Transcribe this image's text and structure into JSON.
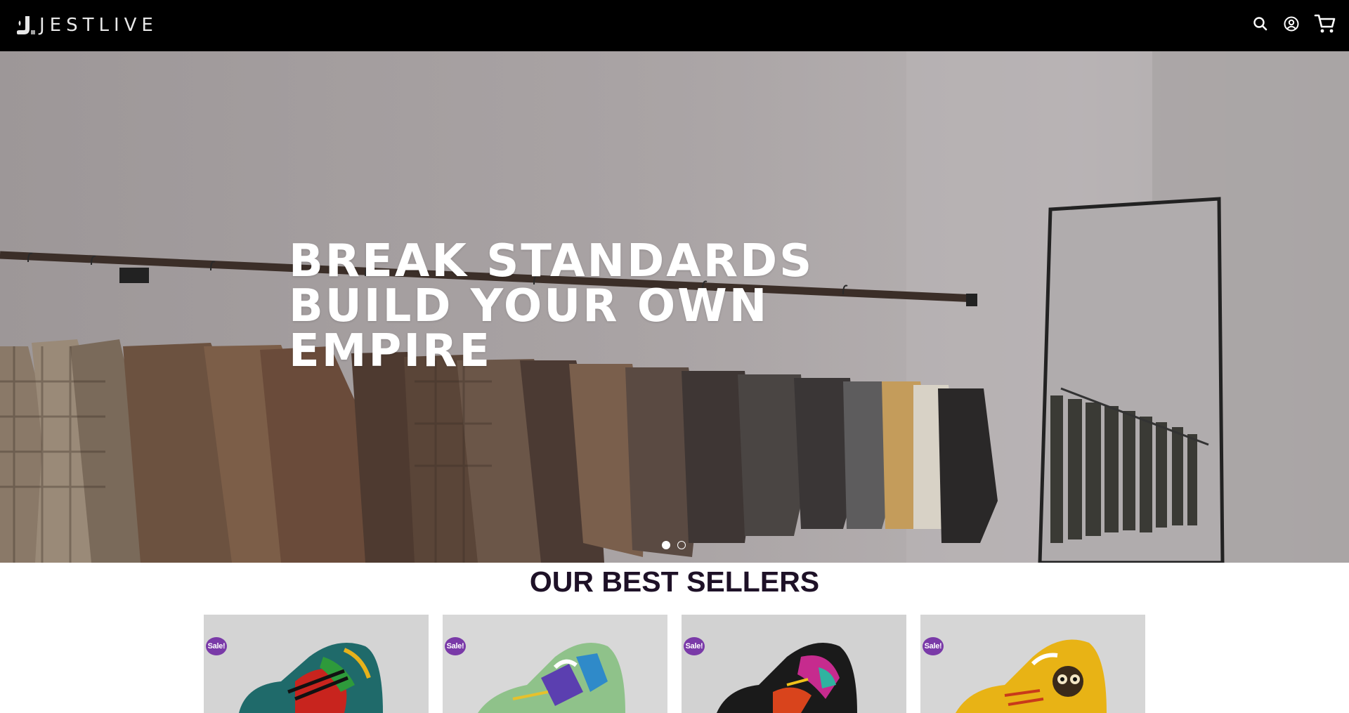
{
  "brand": {
    "name": "JESTLIVE"
  },
  "header": {
    "icons": [
      "search-icon",
      "account-icon",
      "cart-icon"
    ]
  },
  "hero": {
    "headline": [
      "BREAK STANDARDS",
      "BUILD YOUR OWN",
      "EMPIRE"
    ],
    "slides": 2,
    "active_slide": 1
  },
  "best_sellers": {
    "title": "OUR BEST SELLERS",
    "products": [
      {
        "badge": "Sale!",
        "color": "#1f6a6a"
      },
      {
        "badge": "Sale!",
        "color": "#8fc28a"
      },
      {
        "badge": "Sale!",
        "color": "#1a1a1a"
      },
      {
        "badge": "Sale!",
        "color": "#e8b315"
      }
    ]
  },
  "colors": {
    "header_bg": "#000000",
    "badge": "#7a3aa8",
    "title": "#1e1127"
  }
}
